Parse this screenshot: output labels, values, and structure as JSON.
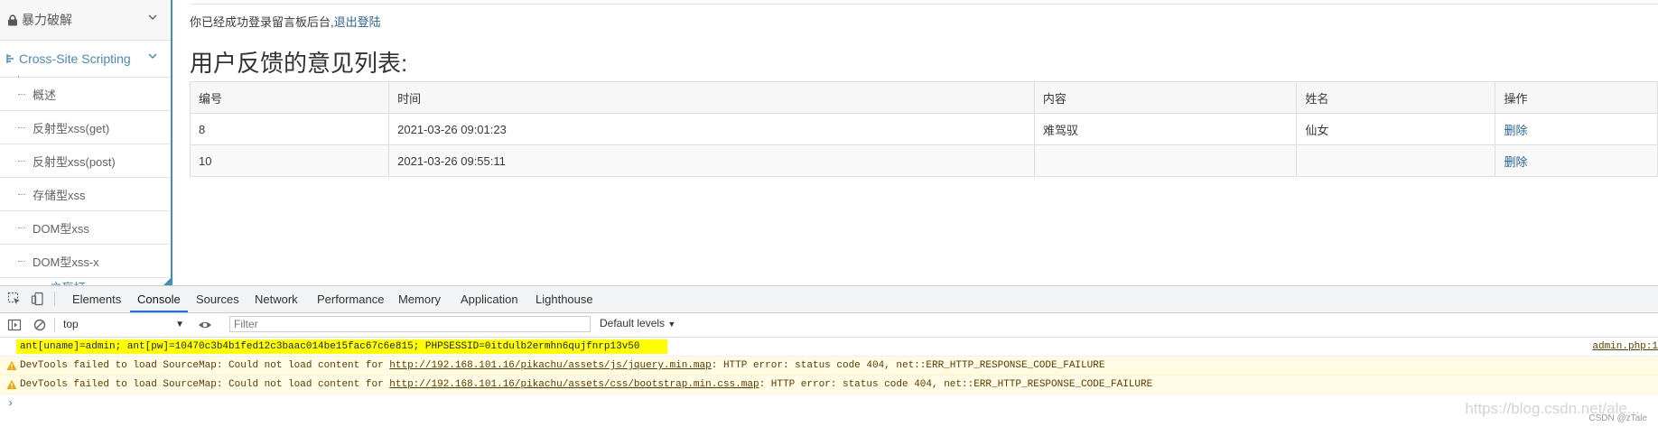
{
  "sidebar": {
    "top_item": "暴力破解",
    "active_section": "Cross-Site Scripting",
    "sub_items": [
      "概述",
      "反射型xss(get)",
      "反射型xss(post)",
      "存储型xss",
      "DOM型xss",
      "DOM型xss-x"
    ],
    "cut_item": "xss之盲打"
  },
  "main": {
    "login_message": "你已经成功登录留言板后台,",
    "logout_link": "退出登陆",
    "list_title": "用户反馈的意见列表:",
    "table": {
      "headers": [
        "编号",
        "时间",
        "内容",
        "姓名",
        "操作"
      ],
      "rows": [
        {
          "id": "8",
          "time": "2021-03-26 09:01:23",
          "content": "难驾驭",
          "name": "仙女",
          "action": "删除"
        },
        {
          "id": "10",
          "time": "2021-03-26 09:55:11",
          "content": "",
          "name": "",
          "action": "删除"
        }
      ]
    }
  },
  "devtools": {
    "tabs": [
      "Elements",
      "Console",
      "Sources",
      "Network",
      "Performance",
      "Memory",
      "Application",
      "Lighthouse"
    ],
    "active_tab": "Console",
    "context": "top",
    "filter_placeholder": "Filter",
    "levels": "Default levels",
    "console": {
      "log_text": "ant[uname]=admin; ant[pw]=10470c3b4b1fed12c3baac014be15fac67c6e815; PHPSESSID=0itdulb2ermhn6qujfnrp13v50",
      "log_source": "admin.php:1",
      "warn1_prefix": "DevTools failed to load SourceMap: Could not load content for ",
      "warn1_link": "http://192.168.101.16/pikachu/assets/js/jquery.min.map",
      "warn1_suffix": ": HTTP error: status code 404, net::ERR_HTTP_RESPONSE_CODE_FAILURE",
      "warn2_prefix": "DevTools failed to load SourceMap: Could not load content for ",
      "warn2_link": "http://192.168.101.16/pikachu/assets/css/bootstrap.min.css.map",
      "warn2_suffix": ": HTTP error: status code 404, net::ERR_HTTP_RESPONSE_CODE_FAILURE",
      "prompt": "›"
    }
  },
  "watermark": "https://blog.csdn.net/ale...",
  "watermark_small": "CSDN @zTale"
}
